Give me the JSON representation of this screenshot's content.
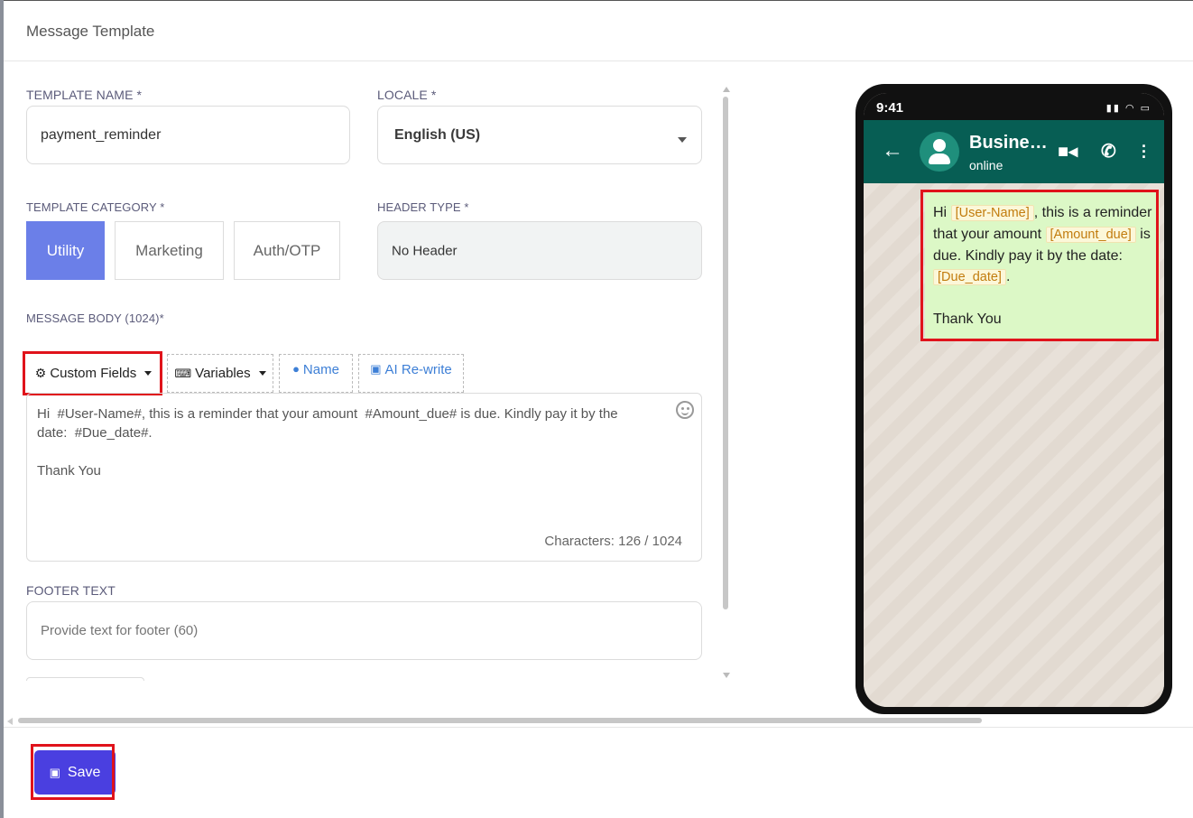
{
  "modal": {
    "title": "Message Template"
  },
  "form": {
    "template_name": {
      "label": "TEMPLATE NAME *",
      "value": "payment_reminder"
    },
    "locale": {
      "label": "LOCALE *",
      "value": "English (US)"
    },
    "template_category": {
      "label": "TEMPLATE CATEGORY *",
      "options": [
        "Utility",
        "Marketing",
        "Auth/OTP"
      ],
      "selected": "Utility"
    },
    "header_type": {
      "label": "HEADER TYPE *",
      "value": "No Header"
    },
    "message_body": {
      "label": "MESSAGE BODY (1024)*",
      "toolbar": {
        "custom_fields": "Custom Fields",
        "variables": "Variables",
        "name": "Name",
        "ai_rewrite": "AI Re-write"
      },
      "value": "Hi  #User-Name#, this is a reminder that your amount  #Amount_due# is due. Kindly pay it by the\ndate:  #Due_date#.\n\nThank You",
      "char_count": "Characters: 126 / 1024"
    },
    "footer": {
      "label": "FOOTER TEXT",
      "placeholder": "Provide text for footer (60)"
    }
  },
  "actions": {
    "save_label": "Save"
  },
  "preview": {
    "time": "9:41",
    "business_name": "Busines...",
    "status": "online",
    "message": {
      "part1": "Hi ",
      "var1": "[User-Name]",
      "part2": ", this is a reminder that your amount ",
      "var2": "[Amount_due]",
      "part3": " is due. Kindly pay it by the date: ",
      "var3": "[Due_date]",
      "part4": ".",
      "closing": "Thank You"
    }
  },
  "colors": {
    "accent": "#6b7fe8",
    "save": "#4a3fe0",
    "whatsapp_header": "#075e54",
    "bubble": "#dcf8c6",
    "highlight": "#e0131b"
  }
}
